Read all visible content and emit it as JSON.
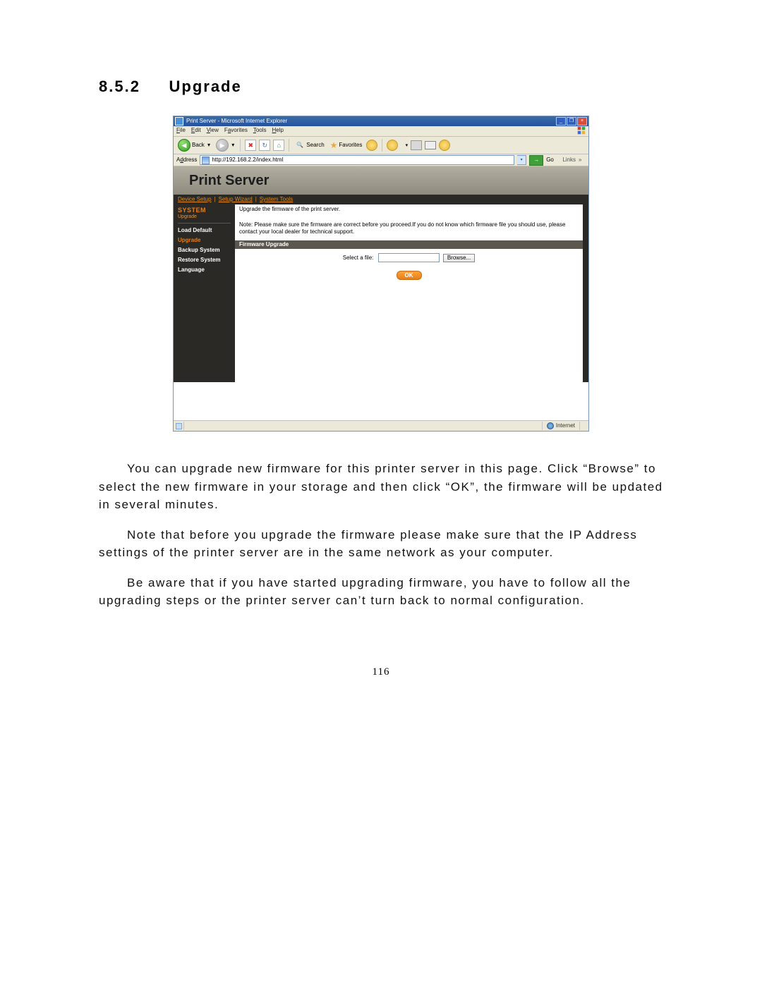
{
  "doc": {
    "section_number": "8.5.2",
    "section_title": "Upgrade",
    "para1": "You can upgrade new firmware for this printer server in this page. Click “Browse” to select the new firmware in your storage and then click “OK”, the firmware will be updated in several minutes.",
    "para2": "Note that before you upgrade the firmware please make sure that the IP Address settings of the printer server are in the same network as your computer.",
    "para3": "Be aware that if you have started upgrading firmware, you have to follow all the upgrading steps or the printer server can’t turn back to normal configuration.",
    "page_number": "116"
  },
  "browser": {
    "window_title": "Print Server - Microsoft Internet Explorer",
    "menu": {
      "file": "File",
      "edit": "Edit",
      "view": "View",
      "favorites": "Favorites",
      "tools": "Tools",
      "help": "Help"
    },
    "toolbar": {
      "back_label": "Back",
      "search_label": "Search",
      "favorites_label": "Favorites"
    },
    "address_label": "Address",
    "address_value": "http://192.168.2.2/index.html",
    "go_label": "Go",
    "links_label": "Links",
    "status_zone": "Internet"
  },
  "app": {
    "banner_title": "Print Server",
    "topnav": [
      "Device Setup",
      "Setup Wizard",
      "System Tools"
    ],
    "sidebar": {
      "group_title": "SYSTEM",
      "group_sub": "Upgrade",
      "items": [
        "Load Default",
        "Upgrade",
        "Backup System",
        "Restore System",
        "Language"
      ],
      "active_index": 1
    },
    "content": {
      "intro": "Upgrade the firmware of the print server.",
      "note": "Note: Please make sure the firmware are correct before you proceed.If you do not know which firmware file you should use, please contact your local dealer for technical support.",
      "section_bar": "Firmware Upgrade",
      "file_label": "Select a file:",
      "browse_label": "Browse...",
      "ok_label": "OK"
    }
  }
}
